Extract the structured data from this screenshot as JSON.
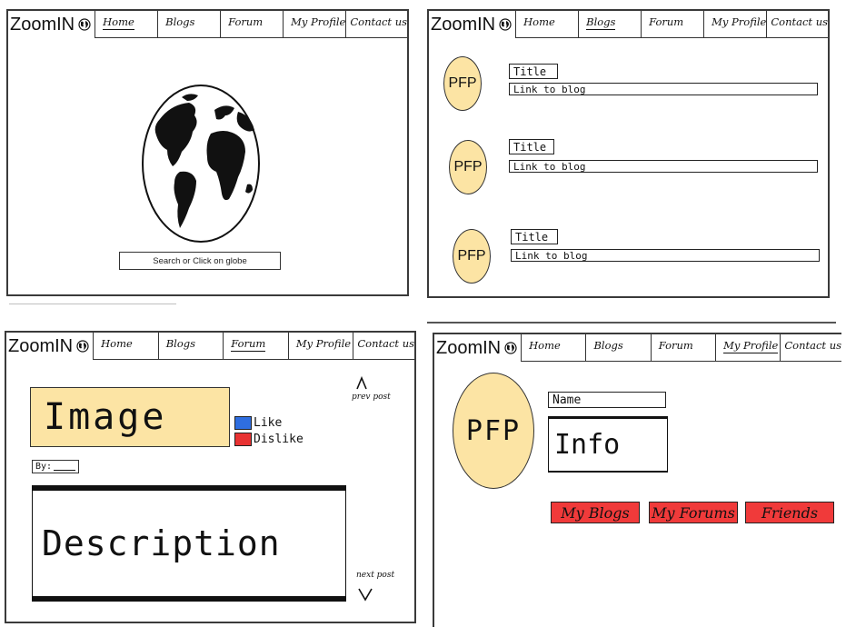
{
  "app": {
    "brand": "ZoomIN",
    "brand_icon": "globe-icon"
  },
  "nav": {
    "tabs": [
      "Home",
      "Blogs",
      "Forum",
      "My Profile",
      "Contact us"
    ]
  },
  "home": {
    "search_placeholder": "Search or Click on globe",
    "active_tab": "Home"
  },
  "blogs": {
    "active_tab": "Blogs",
    "items": [
      {
        "avatar": "PFP",
        "title": "Title",
        "link": "Link to blog"
      },
      {
        "avatar": "PFP",
        "title": "Title",
        "link": "Link to blog"
      },
      {
        "avatar": "PFP",
        "title": "Title",
        "link": "Link to blog"
      }
    ]
  },
  "forum": {
    "active_tab": "Forum",
    "image_label": "Image",
    "like_label": "Like",
    "dislike_label": "Dislike",
    "by_label": "By:",
    "description_label": "Description",
    "prev_label": "prev post",
    "next_label": "next post",
    "colors": {
      "like": "#2f6ee0",
      "dislike": "#e83232",
      "image_bg": "#fce4a4"
    }
  },
  "profile": {
    "active_tab": "My Profile",
    "avatar": "PFP",
    "name_label": "Name",
    "info_label": "Info",
    "buttons": [
      "My Blogs",
      "My Forums",
      "Friends"
    ],
    "colors": {
      "buttons": "#f03a3a",
      "avatar_bg": "#fce4a4"
    }
  }
}
